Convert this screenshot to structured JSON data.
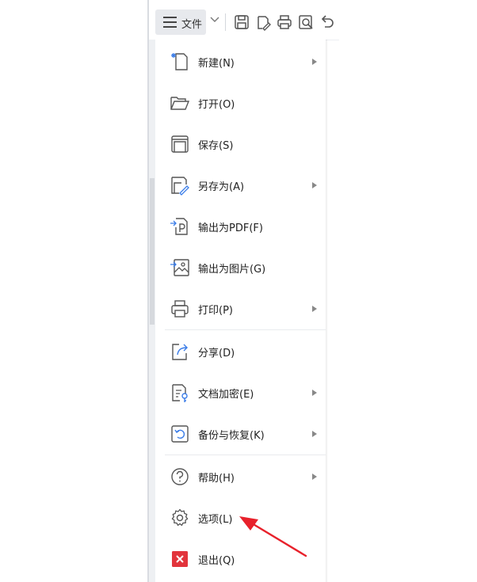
{
  "toolbar": {
    "file_label": "文件",
    "icons": [
      "save-icon",
      "save-as-icon",
      "print-icon",
      "print-preview-icon",
      "undo-icon"
    ]
  },
  "menu": {
    "items": [
      {
        "label": "新建(N)",
        "icon": "new-file-icon",
        "has_submenu": true
      },
      {
        "label": "打开(O)",
        "icon": "open-folder-icon",
        "has_submenu": false
      },
      {
        "label": "保存(S)",
        "icon": "save-icon",
        "has_submenu": false
      },
      {
        "label": "另存为(A)",
        "icon": "save-as-icon",
        "has_submenu": true
      },
      {
        "label": "输出为PDF(F)",
        "icon": "export-pdf-icon",
        "has_submenu": false
      },
      {
        "label": "输出为图片(G)",
        "icon": "export-image-icon",
        "has_submenu": false
      },
      {
        "label": "打印(P)",
        "icon": "print-icon",
        "has_submenu": true
      },
      {
        "label": "分享(D)",
        "icon": "share-icon",
        "has_submenu": false
      },
      {
        "label": "文档加密(E)",
        "icon": "encrypt-document-icon",
        "has_submenu": true
      },
      {
        "label": "备份与恢复(K)",
        "icon": "backup-restore-icon",
        "has_submenu": true
      },
      {
        "label": "帮助(H)",
        "icon": "help-icon",
        "has_submenu": true
      },
      {
        "label": "选项(L)",
        "icon": "settings-gear-icon",
        "has_submenu": false
      },
      {
        "label": "退出(Q)",
        "icon": "exit-icon",
        "has_submenu": false
      }
    ]
  },
  "colors": {
    "accent_blue": "#3b7de8",
    "exit_red": "#e2343c",
    "annotation_red": "#e8212b",
    "icon_gray": "#555555"
  }
}
